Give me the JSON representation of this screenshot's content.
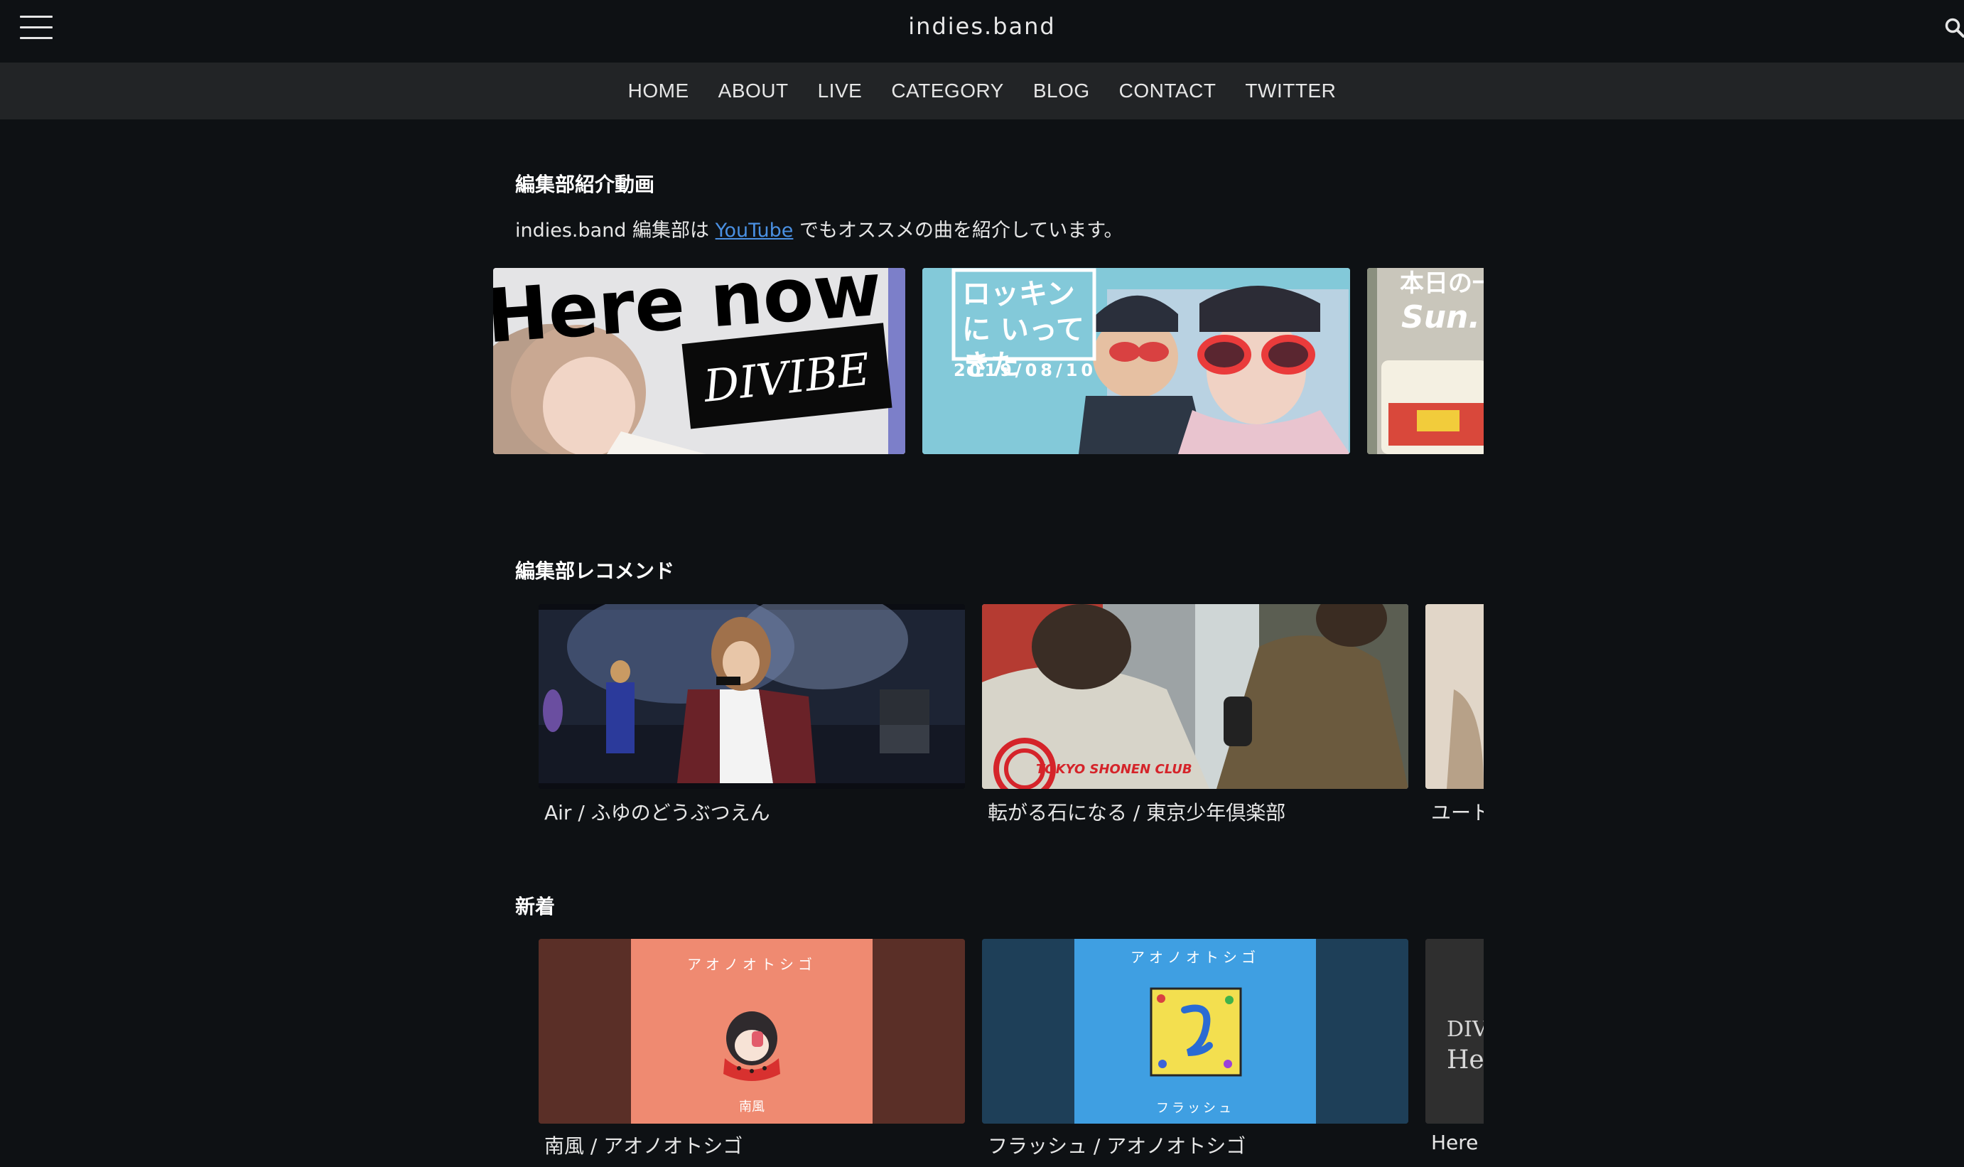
{
  "header": {
    "site_title": "indies.band",
    "menu_icon": "hamburger-menu-icon",
    "search_icon": "search-icon"
  },
  "nav": {
    "items": [
      {
        "label": "HOME"
      },
      {
        "label": "ABOUT"
      },
      {
        "label": "LIVE"
      },
      {
        "label": "CATEGORY"
      },
      {
        "label": "BLOG"
      },
      {
        "label": "CONTACT"
      },
      {
        "label": "TWITTER"
      }
    ]
  },
  "videos": {
    "title": "編集部紹介動画",
    "intro_before": "indies.band 編集部は ",
    "intro_link": "YouTube",
    "intro_after": " でもオススメの曲を紹介しています。",
    "thumbs": [
      {
        "caption_main": "Here now",
        "caption_badge": "DIVIBE"
      },
      {
        "caption_main": "ロッキンに いってきた",
        "caption_date": "2019/08/10"
      },
      {
        "caption_main": "本日の一",
        "caption_sub": "Sun."
      }
    ]
  },
  "recommend": {
    "title": "編集部レコメンド",
    "items": [
      {
        "label": "Air / ふゆのどうぶつえん"
      },
      {
        "label": "転がる石になる / 東京少年倶楽部",
        "logo_text": "TOKYO SHONEN CLUB"
      },
      {
        "label": "ユート"
      }
    ]
  },
  "latest": {
    "title": "新着",
    "items": [
      {
        "label": "南風 / アオノオトシゴ",
        "art_top": "アオノオトシゴ",
        "art_bottom": "南風"
      },
      {
        "label": "フラッシュ / アオノオトシゴ",
        "art_top": "アオノオトシゴ",
        "art_bottom": "フラッシュ"
      },
      {
        "label": "Here r",
        "art_text_1": "DIV",
        "art_text_2": "He"
      }
    ]
  },
  "colors": {
    "background": "#0e1114",
    "nav_background": "#222426",
    "link": "#4a90e2"
  }
}
